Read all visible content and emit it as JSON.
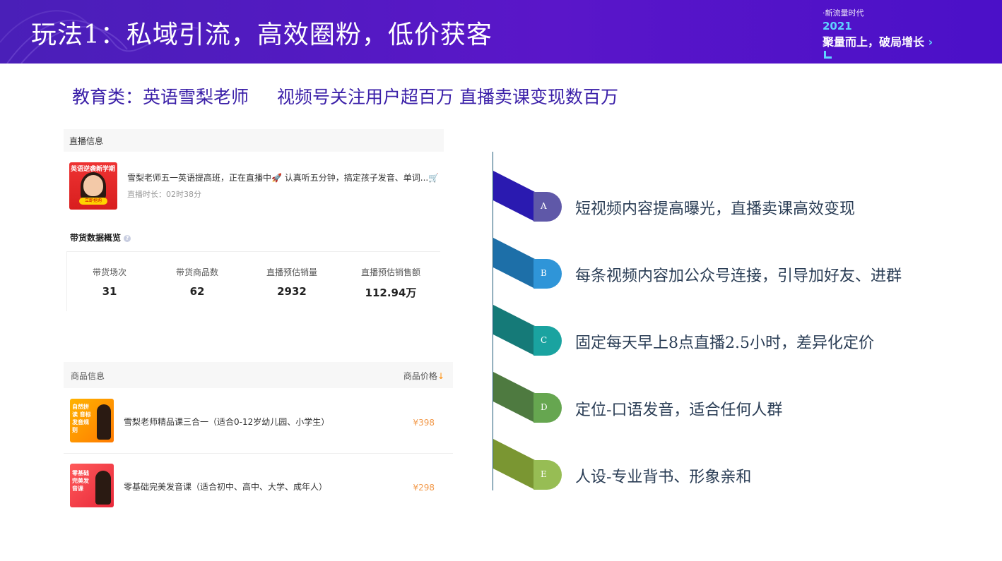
{
  "header": {
    "title": "玩法1：私域引流，高效圈粉，低价获客",
    "brand_small": "·新流量时代",
    "brand_year": "2021",
    "brand_slogan": "聚量而上，破局增长",
    "brand_chevron": "›"
  },
  "subtitle": {
    "left": "教育类：英语雪梨老师",
    "right": "视频号关注用户超百万 直播卖课变现数百万"
  },
  "live": {
    "section_label": "直播信息",
    "thumb_text": "英语逆袭新学期",
    "thumb_button": "立即抢购",
    "title": "雪梨老师五一英语提高班，正在直播中🚀 认真听五分钟，搞定孩子发音、单词...",
    "cart_icon": "cart-icon",
    "duration": "直播时长：02时38分"
  },
  "overview": {
    "title": "带货数据概览",
    "help": "?",
    "stats": [
      {
        "label": "带货场次",
        "value": "31"
      },
      {
        "label": "带货商品数",
        "value": "62"
      },
      {
        "label": "直播预估销量",
        "value": "2932"
      },
      {
        "label": "直播预估销售额",
        "value": "112.94万"
      }
    ]
  },
  "goods": {
    "header_left": "商品信息",
    "header_right": "商品价格",
    "sort_arrow": "↓",
    "items": [
      {
        "name": "雪梨老师精品课三合一（适合0-12岁幼儿园、小学生）",
        "price": "¥398",
        "thumb_text": "自然拼读 音标 发音规则"
      },
      {
        "name": "零基础完美发音课（适合初中、高中、大学、成年人）",
        "price": "¥298",
        "thumb_text": "零基础 完美发音课"
      }
    ]
  },
  "points": [
    {
      "letter": "A",
      "text": "短视频内容提高曝光，直播卖课高效变现",
      "color_tail": "#2a1ab0",
      "color_cap": "#5f58a8"
    },
    {
      "letter": "B",
      "text": "每条视频内容加公众号连接，引导加好友、进群",
      "color_tail": "#1d6fa8",
      "color_cap": "#2f95d8"
    },
    {
      "letter": "C",
      "text": "固定每天早上8点直播2.5小时，差异化定价",
      "color_tail": "#157a78",
      "color_cap": "#1aa3a0"
    },
    {
      "letter": "D",
      "text": "定位-口语发音，适合任何人群",
      "color_tail": "#4e7a40",
      "color_cap": "#66a650"
    },
    {
      "letter": "E",
      "text": "人设-专业背书、形象亲和",
      "color_tail": "#7a9632",
      "color_cap": "#97bd54"
    }
  ]
}
